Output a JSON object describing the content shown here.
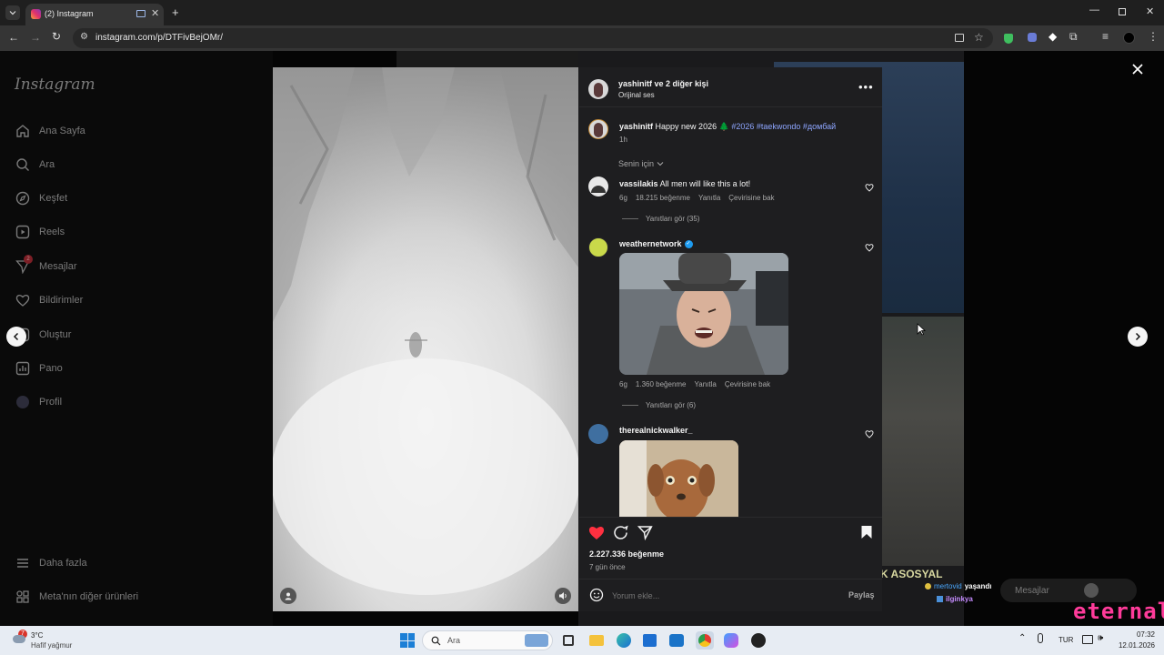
{
  "browser": {
    "tab_title": "(2) Instagram",
    "url": "instagram.com/p/DTFivBejOMr/"
  },
  "sidebar": {
    "logo": "Instagram",
    "items": [
      {
        "label": "Ana Sayfa",
        "icon": "home-icon"
      },
      {
        "label": "Ara",
        "icon": "search-icon"
      },
      {
        "label": "Keşfet",
        "icon": "compass-icon"
      },
      {
        "label": "Reels",
        "icon": "reels-icon"
      },
      {
        "label": "Mesajlar",
        "icon": "messenger-icon",
        "badge": "2"
      },
      {
        "label": "Bildirimler",
        "icon": "heart-icon"
      },
      {
        "label": "Oluştur",
        "icon": "plus-square-icon"
      },
      {
        "label": "Pano",
        "icon": "dashboard-icon"
      },
      {
        "label": "Profil",
        "icon": "avatar-icon"
      }
    ],
    "more": "Daha fazla",
    "meta": "Meta'nın diğer ürünleri"
  },
  "post": {
    "header_user": "yashinitf",
    "header_rest": " ve 2 diğer kişi",
    "audio": "Orijinal ses",
    "caption_user": "yashinitf",
    "caption_text": "Happy new 2026 🌲",
    "caption_tags": "#2026 #taekwondo #домбай",
    "caption_time": "1h",
    "filter": "Senin için",
    "comments": [
      {
        "user": "vassilakis",
        "text": "All men will like this a lot!",
        "age": "6g",
        "likes": "18.215 beğenme",
        "reply": "Yanıtla",
        "translate": "Çevirisine bak",
        "view_replies": "Yanıtları gör (35)"
      },
      {
        "user": "weathernetwork",
        "verified": true,
        "age": "6g",
        "likes": "1.360 beğenme",
        "reply": "Yanıtla",
        "translate": "Çevirisine bak",
        "view_replies": "Yanıtları gör (6)"
      },
      {
        "user": "therealnickwalker_"
      }
    ],
    "likes": "2.227.336 beğenme",
    "posted": "7 gün önce",
    "comment_placeholder": "Yorum ekle...",
    "share": "Paylaş"
  },
  "background": {
    "overlay_text": "K ASOSYAL",
    "chat1_user": "mertovid",
    "chat1_text": "yaşandı",
    "chat2_user": "ilginkya",
    "messages_label": "Mesajlar",
    "watermark": "eternal"
  },
  "taskbar": {
    "weather_temp": "3°C",
    "weather_desc": "Hafif yağmur",
    "weather_badge": "7",
    "search": "Ara",
    "lang": "TUR",
    "time": "07:32",
    "date": "12.01.2026"
  },
  "colors": {
    "like_red": "#ff3040",
    "tag_blue": "#8ea6ff",
    "verified_blue": "#1d9bf0"
  }
}
